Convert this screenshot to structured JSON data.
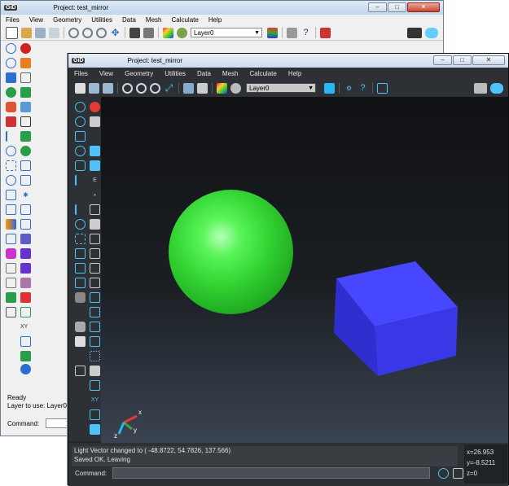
{
  "back_window": {
    "app_badge": "GiD",
    "title": "Project: test_mirror",
    "menu": [
      "Files",
      "View",
      "Geometry",
      "Utilities",
      "Data",
      "Mesh",
      "Calculate",
      "Help"
    ],
    "layer_combo": "Layer0",
    "status_lines": [
      "Ready",
      "Layer to use: Layer0"
    ],
    "command_label": "Command:"
  },
  "front_window": {
    "app_badge": "GiD",
    "title": "Project: test_mirror",
    "menu": [
      "Files",
      "View",
      "Geometry",
      "Utilities",
      "Data",
      "Mesh",
      "Calculate",
      "Help"
    ],
    "layer_combo": "Layer0",
    "messages": [
      "Light Vector changed to ( -48.8722, 54.7826, 137.566)",
      "Saved OK. Leaving"
    ],
    "command_label": "Command:",
    "coords": {
      "x": "x=26.953",
      "y": "y=-8.5211",
      "z": "z=0"
    },
    "axis_labels": {
      "x": "x",
      "y": "y",
      "z": "z"
    }
  },
  "window_buttons": {
    "minimize": "–",
    "maximize": "□",
    "close": "✕"
  },
  "colors": {
    "sphere": "#33d433",
    "cube_front": "#3838e6",
    "cube_top": "#4747ff",
    "cube_side": "#2a2ab8",
    "viewport_bg": "#1b1f24"
  },
  "icons": [
    "new-file-icon",
    "open-folder-icon",
    "save-icon",
    "view-icon",
    "zoom-icon",
    "render-icon",
    "print-icon",
    "layers-icon",
    "help-icon",
    "quit-icon"
  ]
}
